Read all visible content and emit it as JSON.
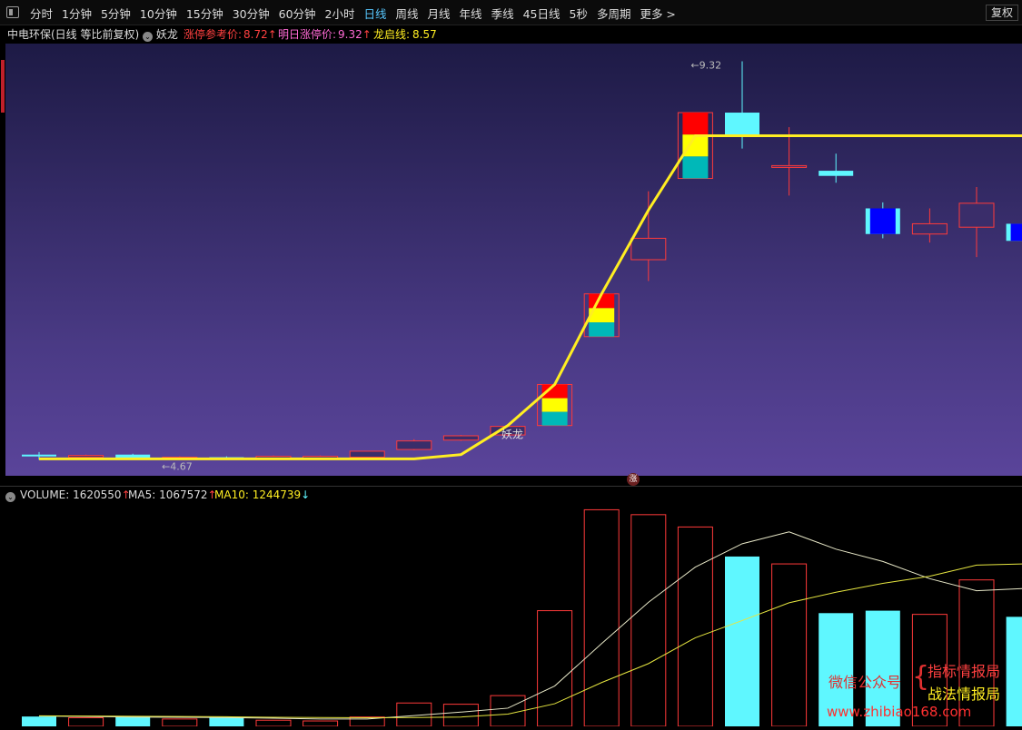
{
  "toolbar": {
    "periods": [
      "分时",
      "1分钟",
      "5分钟",
      "10分钟",
      "15分钟",
      "30分钟",
      "60分钟",
      "2小时",
      "日线",
      "周线",
      "月线",
      "年线",
      "季线",
      "45日线",
      "5秒",
      "多周期",
      "更多 >"
    ],
    "active_period": "日线",
    "fq_label": "复权"
  },
  "info": {
    "stock": "中电环保(日线 等比前复权)",
    "indicator": "妖龙",
    "limit_ref_label": "涨停参考价:",
    "limit_ref_value": "8.72",
    "next_limit_label": "明日涨停价:",
    "next_limit_value": "9.32",
    "dragon_label": "龙启线:",
    "dragon_value": "8.57"
  },
  "annotations": {
    "low_price": "←4.67",
    "high_price": "←9.32",
    "yaolong_mark": "妖龙",
    "zhang_badge": "涨"
  },
  "volume": {
    "volume_label": "VOLUME:",
    "volume_value": "1620550",
    "ma5_label": "MA5:",
    "ma5_value": "1067572",
    "ma10_label": "MA10:",
    "ma10_value": "1244739",
    "arrow_up": "↑",
    "arrow_down": "↓"
  },
  "watermark": {
    "wechat": "微信公众号",
    "brace": "{",
    "line1": "指标情报局",
    "line2": "战法情报局",
    "url": "www.zhibiao168.com"
  },
  "colors": {
    "up": "#ff3a3a",
    "down": "#5ff7ff",
    "limit_down_fill": "#0000ff",
    "line": "#ffee22",
    "red_block": "#ff0000",
    "yellow_block": "#ffff00",
    "teal_block": "#00b8b8"
  },
  "chart_data": [
    {
      "type": "candlestick",
      "candles": [
        {
          "o": 4.72,
          "h": 4.75,
          "l": 4.66,
          "c": 4.7,
          "dir": "down"
        },
        {
          "o": 4.69,
          "h": 4.72,
          "l": 4.67,
          "c": 4.71,
          "dir": "up"
        },
        {
          "o": 4.72,
          "h": 4.73,
          "l": 4.67,
          "c": 4.68,
          "dir": "down"
        },
        {
          "o": 4.68,
          "h": 4.7,
          "l": 4.66,
          "c": 4.69,
          "dir": "up"
        },
        {
          "o": 4.69,
          "h": 4.7,
          "l": 4.67,
          "c": 4.68,
          "dir": "down"
        },
        {
          "o": 4.68,
          "h": 4.71,
          "l": 4.67,
          "c": 4.7,
          "dir": "up"
        },
        {
          "o": 4.7,
          "h": 4.71,
          "l": 4.68,
          "c": 4.69,
          "dir": "up"
        },
        {
          "o": 4.69,
          "h": 4.76,
          "l": 4.68,
          "c": 4.76,
          "dir": "up"
        },
        {
          "o": 4.78,
          "h": 4.9,
          "l": 4.77,
          "c": 4.88,
          "dir": "up"
        },
        {
          "o": 4.89,
          "h": 4.95,
          "l": 4.88,
          "c": 4.94,
          "dir": "up"
        },
        {
          "o": 4.95,
          "h": 5.06,
          "l": 4.94,
          "c": 5.05,
          "dir": "up"
        },
        {
          "o": 5.06,
          "h": 5.54,
          "l": 5.06,
          "c": 5.54,
          "dir": "up",
          "limit": true
        },
        {
          "o": 6.1,
          "h": 6.6,
          "l": 6.1,
          "c": 6.6,
          "dir": "up",
          "limit": true
        },
        {
          "o": 7.0,
          "h": 7.8,
          "l": 6.75,
          "c": 7.25,
          "dir": "up"
        },
        {
          "o": 7.95,
          "h": 8.72,
          "l": 7.95,
          "c": 8.72,
          "dir": "up",
          "limit": true
        },
        {
          "o": 8.72,
          "h": 9.32,
          "l": 8.3,
          "c": 8.45,
          "dir": "down"
        },
        {
          "o": 8.1,
          "h": 8.55,
          "l": 7.75,
          "c": 8.1,
          "dir": "up"
        },
        {
          "o": 8.04,
          "h": 8.24,
          "l": 7.9,
          "c": 7.98,
          "dir": "down"
        },
        {
          "o": 7.6,
          "h": 7.67,
          "l": 7.25,
          "c": 7.3,
          "dir": "down",
          "filled": true
        },
        {
          "o": 7.3,
          "h": 7.6,
          "l": 7.2,
          "c": 7.42,
          "dir": "up"
        },
        {
          "o": 7.38,
          "h": 7.85,
          "l": 7.03,
          "c": 7.66,
          "dir": "up"
        },
        {
          "o": 7.42,
          "h": 7.55,
          "l": 7.2,
          "c": 7.22,
          "dir": "down",
          "filled": true
        },
        {
          "o": 7.1,
          "h": 7.42,
          "l": 6.95,
          "c": 7.15,
          "dir": "up"
        }
      ],
      "dragon_line": [
        4.67,
        4.67,
        4.67,
        4.67,
        4.67,
        4.67,
        4.67,
        4.67,
        4.67,
        4.72,
        5.06,
        5.54,
        6.6,
        7.58,
        8.45,
        8.45,
        8.45,
        8.45,
        8.45,
        8.45,
        8.45,
        8.45,
        8.45
      ],
      "ylim": [
        4.6,
        9.4
      ]
    },
    {
      "type": "bar",
      "volume": [
        40,
        35,
        40,
        30,
        35,
        25,
        22,
        38,
        95,
        90,
        125,
        470,
        880,
        860,
        810,
        690,
        660,
        460,
        470,
        455,
        595,
        445,
        380
      ],
      "ma5": [
        42,
        40,
        38,
        37,
        36,
        33,
        30,
        30,
        44,
        58,
        74,
        164,
        336,
        504,
        647,
        742,
        790,
        720,
        670,
        600,
        551,
        560,
        520
      ],
      "ma10": [
        43,
        42,
        41,
        40,
        39,
        37,
        36,
        35,
        36,
        38,
        50,
        92,
        178,
        255,
        360,
        430,
        502,
        545,
        581,
        610,
        655,
        660,
        640
      ],
      "ylim": [
        0,
        900
      ]
    }
  ]
}
